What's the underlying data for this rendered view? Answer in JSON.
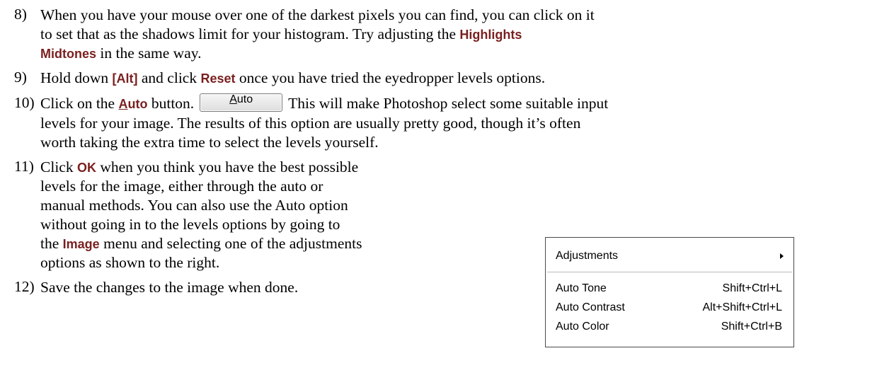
{
  "steps": [
    {
      "number": "8)",
      "lines": [
        {
          "t1": "When you have your mouse over one of the darkest pixels you can find, you can click on it"
        },
        {
          "t1": "to set that as the shadows limit for your histogram. Try adjusting the",
          "kw1": "Highlights"
        },
        {
          "kw1": "Midtones",
          "t2": "in the same way."
        }
      ]
    },
    {
      "number": "9)",
      "lines": [
        {
          "t1": "Hold down",
          "kw1": "[Alt]",
          "t2": "and click",
          "kw2": "Reset",
          "t3": "once you have tried the eyedropper levels options."
        }
      ]
    },
    {
      "number": "10)",
      "lines": [
        {
          "t1": "Click on the",
          "kw1_prefix": "A",
          "kw1_rest": "uto",
          "t2": "button.",
          "button_u": "A",
          "button_rest": "uto",
          "t3": "This will make Photoshop select some suitable input"
        },
        {
          "t1": "levels for your image. The results of this option are usually pretty good, though it’s often"
        },
        {
          "t1": "worth taking the extra time to select the levels yourself."
        }
      ]
    },
    {
      "number": "11)",
      "lines": [
        {
          "t1": "Click",
          "kw1": "OK",
          "t2": "when you think you have the best possible"
        },
        {
          "t1": "levels for the image, either through the auto or"
        },
        {
          "t1": "manual methods. You can also use the Auto option"
        },
        {
          "t1": "without going in to the levels options by going to"
        },
        {
          "t1": "the",
          "kw1": "Image",
          "t2": "menu and selecting one of the adjustments"
        },
        {
          "t1": "options as shown to the right."
        }
      ]
    },
    {
      "number": "12)",
      "lines": [
        {
          "t1": "Save the changes to the image when done."
        }
      ]
    }
  ],
  "menu": {
    "header": "Adjustments",
    "header_icon": "submenu-arrow-icon",
    "items": [
      {
        "label": "Auto Tone",
        "shortcut": "Shift+Ctrl+L"
      },
      {
        "label": "Auto Contrast",
        "shortcut": "Alt+Shift+Ctrl+L"
      },
      {
        "label": "Auto Color",
        "shortcut": "Shift+Ctrl+B"
      }
    ]
  },
  "colors": {
    "keyword": "#7a1f1f",
    "text": "#000000",
    "menu_border": "#4a4a4a"
  }
}
